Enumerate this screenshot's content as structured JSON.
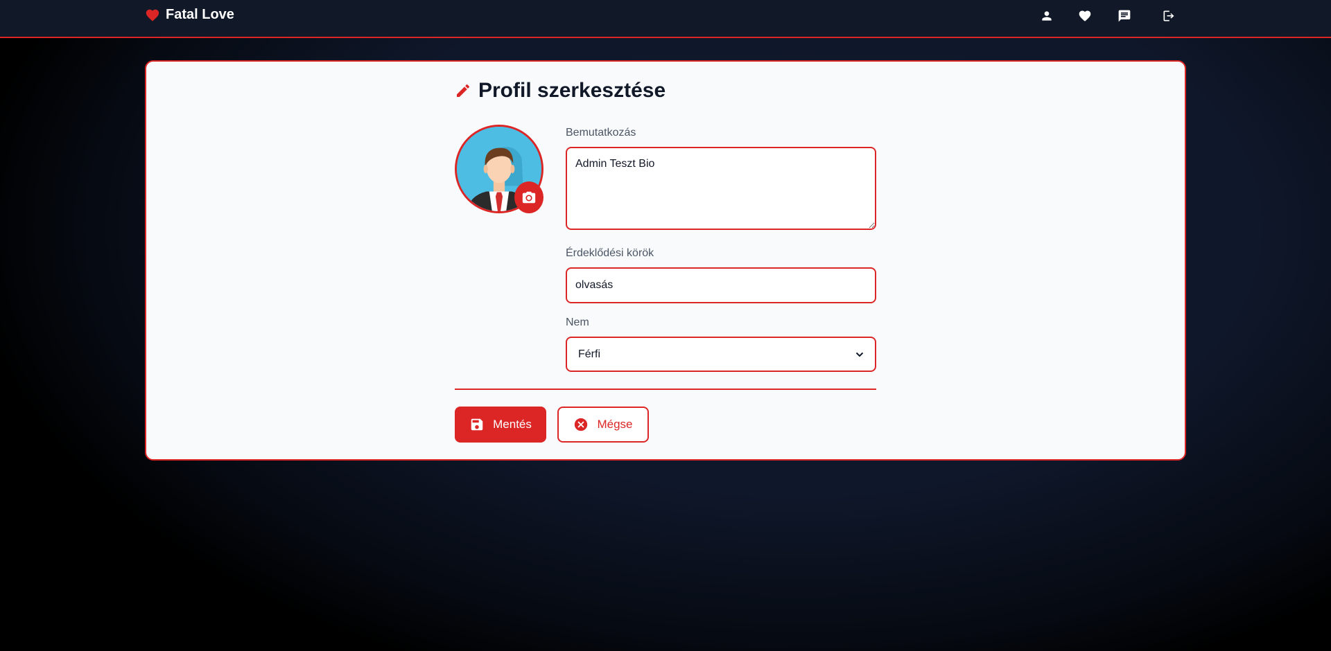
{
  "nav": {
    "brand": "Fatal Love",
    "icons": [
      "heart-icon",
      "user-icon",
      "heart-icon",
      "chat-icon",
      "logout-icon"
    ]
  },
  "page": {
    "title": "Profil szerkesztése",
    "title_icon": "pencil-icon"
  },
  "form": {
    "bio": {
      "label": "Bemutatkozás",
      "value": "Admin Teszt Bio"
    },
    "interests": {
      "label": "Érdeklődési körök",
      "value": "olvasás"
    },
    "gender": {
      "label": "Nem",
      "selected": "Férfi"
    }
  },
  "actions": {
    "save_label": "Mentés",
    "cancel_label": "Mégse"
  },
  "colors": {
    "accent": "#dc2626",
    "nav_bg": "#111827",
    "card_bg": "#f8fafc"
  }
}
